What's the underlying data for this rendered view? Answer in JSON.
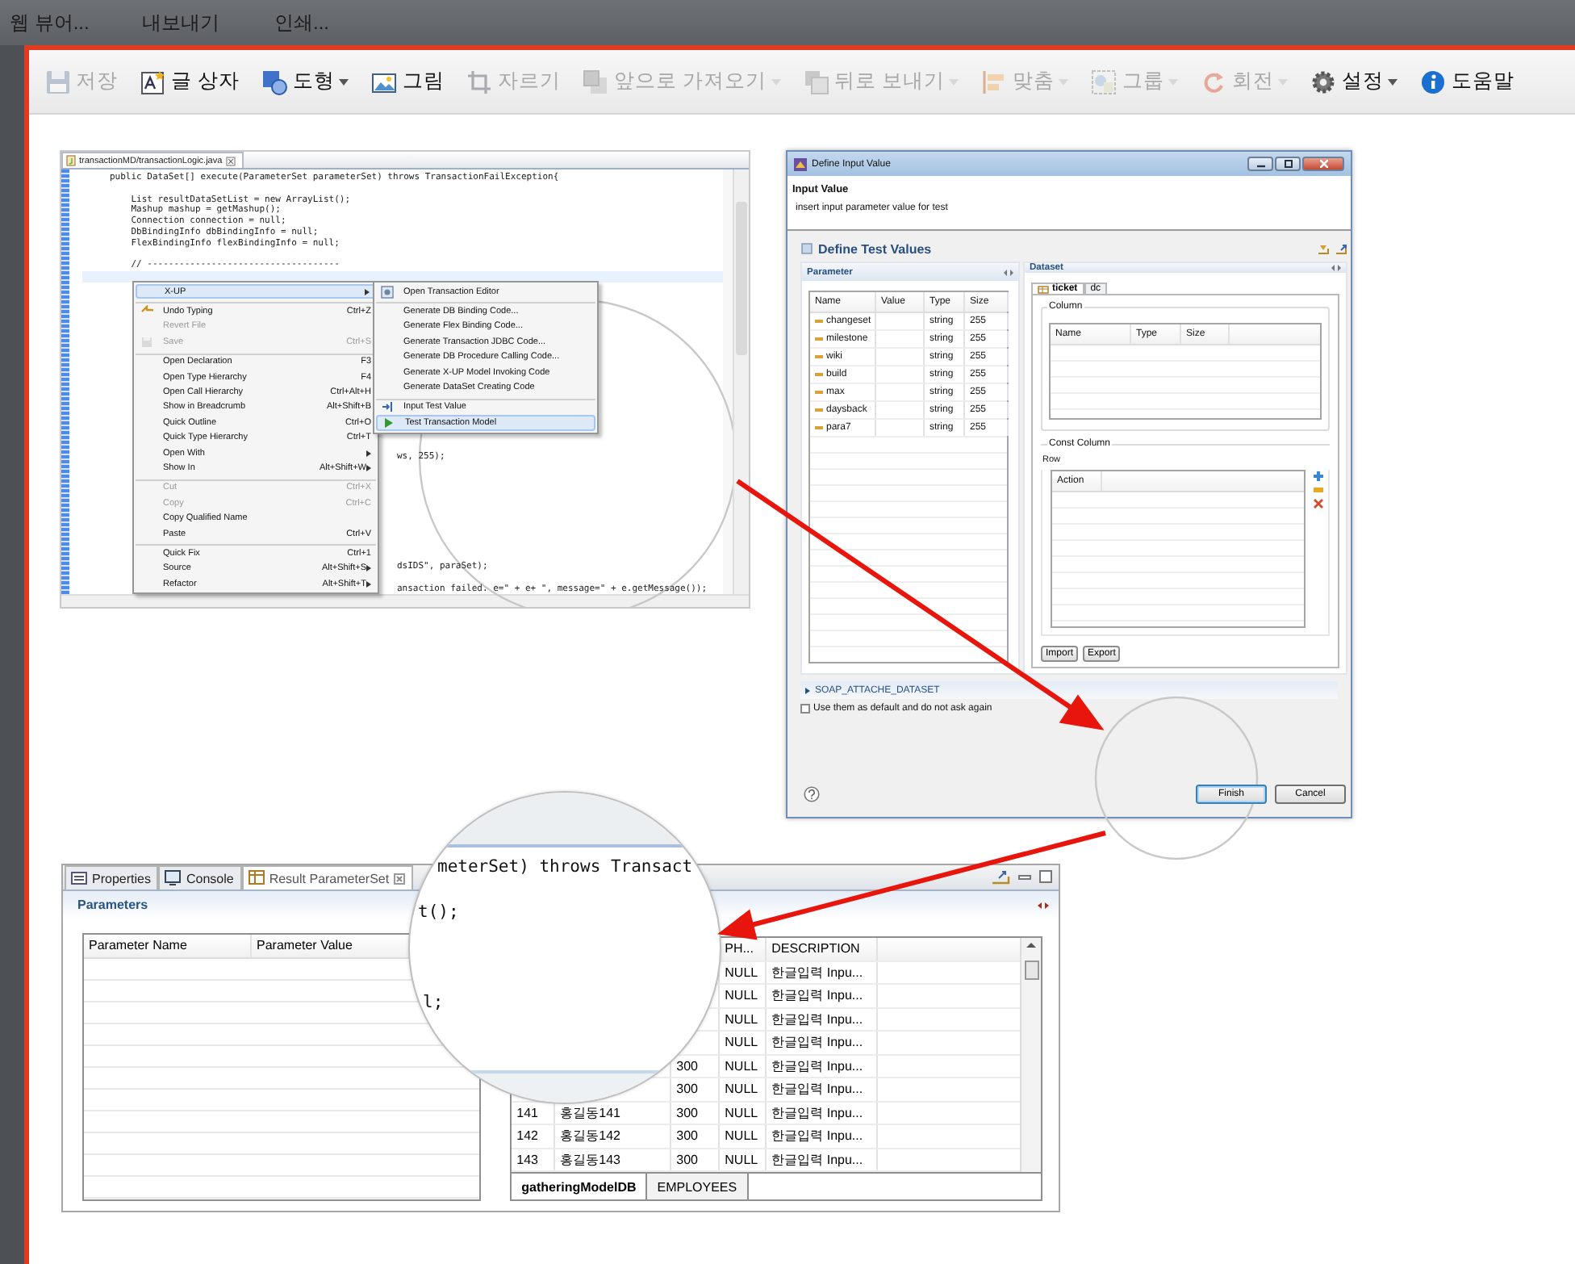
{
  "menu_bar": {
    "items": [
      {
        "label": "웹 뷰어..."
      },
      {
        "label": "내보내기"
      },
      {
        "label": "인쇄..."
      }
    ]
  },
  "toolbar": {
    "items": [
      {
        "kind": "save",
        "label": "저장",
        "disabled": true,
        "dropdown": false
      },
      {
        "kind": "textbox",
        "label": "글 상자",
        "disabled": false,
        "dropdown": false
      },
      {
        "kind": "shape",
        "label": "도형",
        "disabled": false,
        "dropdown": true
      },
      {
        "kind": "picture",
        "label": "그림",
        "disabled": false,
        "dropdown": false
      },
      {
        "kind": "crop",
        "label": "자르기",
        "disabled": true,
        "dropdown": false
      },
      {
        "kind": "front",
        "label": "앞으로 가져오기",
        "disabled": true,
        "dropdown": true
      },
      {
        "kind": "back",
        "label": "뒤로 보내기",
        "disabled": true,
        "dropdown": true
      },
      {
        "kind": "align",
        "label": "맞춤",
        "disabled": true,
        "dropdown": true
      },
      {
        "kind": "group",
        "label": "그룹",
        "disabled": true,
        "dropdown": true
      },
      {
        "kind": "rotate",
        "label": "회전",
        "disabled": true,
        "dropdown": true
      },
      {
        "kind": "settings",
        "label": "설정",
        "disabled": false,
        "dropdown": true
      },
      {
        "kind": "help",
        "label": "도움말",
        "disabled": false,
        "dropdown": false
      }
    ]
  },
  "editor_screenshot": {
    "tab": {
      "title": "transactionMD/transactionLogic.java"
    },
    "code_lines": [
      {
        "text": "public DataSet[] execute(ParameterSet parameterSet) throws TransactionFailException{",
        "blank_before": false
      },
      {
        "text": "    List resultDataSetList = new ArrayList();",
        "blank_before": true
      },
      {
        "text": "    Mashup mashup = getMashup();",
        "blank_before": false
      },
      {
        "text": "    Connection connection = null;",
        "blank_before": false
      },
      {
        "text": "    DbBindingInfo dbBindingInfo = null;",
        "blank_before": false
      },
      {
        "text": "    FlexBindingInfo flexBindingInfo = null;",
        "blank_before": false
      },
      {
        "text": "    // ------------------------------------",
        "blank_before": true
      }
    ],
    "code_fragments": [
      "ws, 255);",
      "dsIDS\", paraSet);",
      "ansaction failed. e=\" + e+ \", message=\" + e.getMessage());"
    ],
    "context_menu": {
      "items": [
        {
          "label": "X-UP",
          "disabled": false,
          "selected": true,
          "submenu": true,
          "separator_before": false
        },
        {
          "label": "Undo Typing",
          "shortcut": "Ctrl+Z",
          "kind": "undo",
          "disabled": false,
          "selected": false,
          "submenu": false,
          "separator_before": true
        },
        {
          "label": "Revert File",
          "disabled": true,
          "selected": false,
          "submenu": false,
          "separator_before": false
        },
        {
          "label": "Save",
          "shortcut": "Ctrl+S",
          "kind": "save",
          "disabled": true,
          "selected": false,
          "submenu": false,
          "separator_before": false
        },
        {
          "label": "Open Declaration",
          "shortcut": "F3",
          "disabled": false,
          "selected": false,
          "submenu": false,
          "separator_before": true
        },
        {
          "label": "Open Type Hierarchy",
          "shortcut": "F4",
          "disabled": false,
          "selected": false,
          "submenu": false,
          "separator_before": false
        },
        {
          "label": "Open Call Hierarchy",
          "shortcut": "Ctrl+Alt+H",
          "disabled": false,
          "selected": false,
          "submenu": false,
          "separator_before": false
        },
        {
          "label": "Show in Breadcrumb",
          "shortcut": "Alt+Shift+B",
          "disabled": false,
          "selected": false,
          "submenu": false,
          "separator_before": false
        },
        {
          "label": "Quick Outline",
          "shortcut": "Ctrl+O",
          "disabled": false,
          "selected": false,
          "submenu": false,
          "separator_before": false
        },
        {
          "label": "Quick Type Hierarchy",
          "shortcut": "Ctrl+T",
          "disabled": false,
          "selected": false,
          "submenu": false,
          "separator_before": false
        },
        {
          "label": "Open With",
          "disabled": false,
          "selected": false,
          "submenu": true,
          "separator_before": false
        },
        {
          "label": "Show In",
          "shortcut": "Alt+Shift+W",
          "disabled": false,
          "selected": false,
          "submenu": true,
          "separator_before": false
        },
        {
          "label": "Cut",
          "shortcut": "Ctrl+X",
          "disabled": true,
          "selected": false,
          "submenu": false,
          "separator_before": true
        },
        {
          "label": "Copy",
          "shortcut": "Ctrl+C",
          "disabled": true,
          "selected": false,
          "submenu": false,
          "separator_before": false
        },
        {
          "label": "Copy Qualified Name",
          "disabled": false,
          "selected": false,
          "submenu": false,
          "separator_before": false
        },
        {
          "label": "Paste",
          "shortcut": "Ctrl+V",
          "disabled": false,
          "selected": false,
          "submenu": false,
          "separator_before": false
        },
        {
          "label": "Quick Fix",
          "shortcut": "Ctrl+1",
          "disabled": false,
          "selected": false,
          "submenu": false,
          "separator_before": true
        },
        {
          "label": "Source",
          "shortcut": "Alt+Shift+S",
          "disabled": false,
          "selected": false,
          "submenu": true,
          "separator_before": false
        },
        {
          "label": "Refactor",
          "shortcut": "Alt+Shift+T",
          "disabled": false,
          "selected": false,
          "submenu": true,
          "separator_before": false
        }
      ]
    },
    "submenu": {
      "items": [
        {
          "label": "Open Transaction Editor",
          "kind": "editor",
          "disabled": false,
          "selected": false,
          "separator_before": false
        },
        {
          "label": "Generate DB Binding Code...",
          "disabled": false,
          "selected": false,
          "separator_before": true
        },
        {
          "label": "Generate Flex Binding Code...",
          "disabled": false,
          "selected": false,
          "separator_before": false
        },
        {
          "label": "Generate Transaction JDBC Code...",
          "disabled": false,
          "selected": false,
          "separator_before": false
        },
        {
          "label": "Generate DB Procedure Calling Code...",
          "disabled": false,
          "selected": false,
          "separator_before": false
        },
        {
          "label": "Generate X-UP Model Invoking Code",
          "disabled": false,
          "selected": false,
          "separator_before": false
        },
        {
          "label": "Generate DataSet Creating Code",
          "disabled": false,
          "selected": false,
          "separator_before": false
        },
        {
          "label": "Input Test Value",
          "kind": "input",
          "disabled": false,
          "selected": false,
          "separator_before": true
        },
        {
          "label": "Test Transaction Model",
          "kind": "run",
          "disabled": false,
          "selected": true,
          "separator_before": false
        }
      ]
    }
  },
  "dialog": {
    "title": "Define Input Value",
    "header": {
      "title": "Input Value",
      "subtitle": "insert input parameter value for test"
    },
    "section_title": "Define Test Values",
    "parameter_panel": {
      "title": "Parameter",
      "columns": [
        "Name",
        "Value",
        "Type",
        "Size"
      ],
      "rows": [
        {
          "name": "changeset",
          "type": "string",
          "size": "255"
        },
        {
          "name": "milestone",
          "type": "string",
          "size": "255"
        },
        {
          "name": "wiki",
          "type": "string",
          "size": "255"
        },
        {
          "name": "build",
          "type": "string",
          "size": "255"
        },
        {
          "name": "max",
          "type": "string",
          "size": "255"
        },
        {
          "name": "daysback",
          "type": "string",
          "size": "255"
        },
        {
          "name": "para7",
          "type": "string",
          "size": "255"
        }
      ]
    },
    "dataset_panel": {
      "title": "Dataset",
      "tabs": [
        {
          "label": "ticket",
          "selected": true
        },
        {
          "label": "dc",
          "selected": false
        }
      ],
      "column_group": {
        "title": "Column",
        "columns": [
          "Name",
          "Type",
          "Size"
        ]
      },
      "const_column_group": {
        "title": "Const Column"
      },
      "row_label": "Row",
      "row_columns": [
        "Action"
      ],
      "buttons": [
        "Import",
        "Export"
      ]
    },
    "expander": {
      "label": "SOAP_ATTACHE_DATASET",
      "expanded": false
    },
    "checkbox": {
      "label": "Use them as default and do not ask again",
      "checked": false
    },
    "buttons": [
      {
        "label": "Finish",
        "default": true
      },
      {
        "label": "Cancel",
        "default": false
      }
    ]
  },
  "result_panel": {
    "tabs": [
      {
        "label": "Properties",
        "kind": "properties",
        "selected": false
      },
      {
        "label": "Console",
        "kind": "console",
        "selected": false
      },
      {
        "label": "Result ParameterSet",
        "kind": "table",
        "selected": true
      }
    ],
    "section_title": "Parameters",
    "parameter_table": {
      "columns": [
        "Parameter Name",
        "Parameter Value"
      ]
    },
    "result_table": {
      "columns": [
        "PH...",
        "DESCRIPTION"
      ],
      "rows": [
        {
          "ph": "NULL",
          "description": "한글입력 Inpu..."
        },
        {
          "ph": "NULL",
          "description": "한글입력 Inpu..."
        },
        {
          "ph": "NULL",
          "description": "한글입력 Inpu..."
        },
        {
          "ph": "NULL",
          "description": "한글입력 Inpu..."
        },
        {
          "value": "300",
          "ph": "NULL",
          "description": "한글입력 Inpu..."
        },
        {
          "value": "300",
          "ph": "NULL",
          "description": "한글입력 Inpu..."
        },
        {
          "no": "141",
          "name": "홍길동141",
          "value": "300",
          "ph": "NULL",
          "description": "한글입력 Inpu..."
        },
        {
          "no": "142",
          "name": "홍길동142",
          "value": "300",
          "ph": "NULL",
          "description": "한글입력 Inpu..."
        },
        {
          "no": "143",
          "name": "홍길동143",
          "value": "300",
          "ph": "NULL",
          "description": "한글입력 Inpu..."
        }
      ],
      "tabs": [
        {
          "label": "gatheringModelDB",
          "selected": true
        },
        {
          "label": "EMPLOYEES",
          "selected": false
        }
      ]
    }
  },
  "magnifier": {
    "lines": [
      "meterSet) throws Transact",
      "t();",
      "l;"
    ]
  }
}
